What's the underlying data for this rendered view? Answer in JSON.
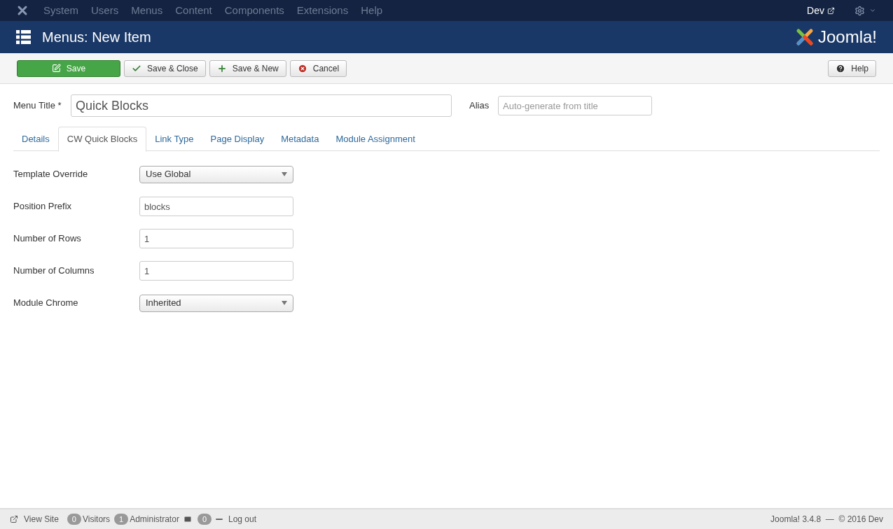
{
  "top_menu": {
    "items": [
      "System",
      "Users",
      "Menus",
      "Content",
      "Components",
      "Extensions",
      "Help"
    ],
    "site_link": "Dev"
  },
  "header": {
    "title": "Menus: New Item",
    "logo_text": "Joomla!"
  },
  "toolbar": {
    "buttons": [
      {
        "label": "Save",
        "kind": "primary"
      },
      {
        "label": "Save & Close",
        "kind": "default"
      },
      {
        "label": "Save & New",
        "kind": "default"
      },
      {
        "label": "Cancel",
        "kind": "default"
      }
    ],
    "help": "Help"
  },
  "title_field": {
    "label": "Menu Title *",
    "value": "Quick Blocks"
  },
  "alias_field": {
    "label": "Alias",
    "placeholder": "Auto-generate from title"
  },
  "tabs": [
    {
      "label": "Details",
      "selected": false
    },
    {
      "label": "CW Quick Blocks",
      "selected": true
    },
    {
      "label": "Link Type",
      "selected": false
    },
    {
      "label": "Page Display",
      "selected": false
    },
    {
      "label": "Metadata",
      "selected": false
    },
    {
      "label": "Module Assignment",
      "selected": false
    }
  ],
  "fields": [
    {
      "label": "Template Override",
      "kind": "select",
      "value": "Use Global"
    },
    {
      "label": "Position Prefix",
      "kind": "text",
      "value": "blocks"
    },
    {
      "label": "Number of Rows",
      "kind": "text",
      "value": "1"
    },
    {
      "label": "Number of Columns",
      "kind": "text",
      "value": "1"
    },
    {
      "label": "Module Chrome",
      "kind": "select",
      "value": "Inherited"
    }
  ],
  "status_bar": {
    "view_site": "View Site",
    "visitors_count": "0",
    "visitors": "Visitors",
    "admin_count": "1",
    "admin": "Administrator",
    "messages_count": "0",
    "logout": "Log out",
    "version": "Joomla! 3.4.8  —  © 2016 Dev"
  }
}
